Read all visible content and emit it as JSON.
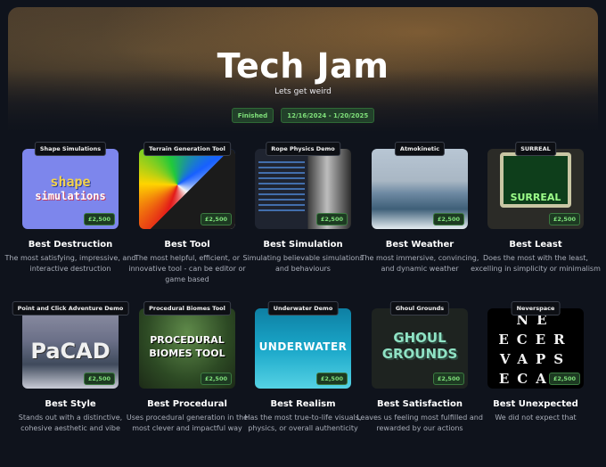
{
  "header": {
    "title": "Tech Jam",
    "subtitle": "Lets get weird",
    "status": "Finished",
    "dates": "12/16/2024 - 1/20/2025"
  },
  "categories": [
    {
      "tag": "Shape Simulations",
      "price": "£2,500",
      "title": "Best Destruction",
      "desc": "The most satisfying, impressive, and interactive destruction",
      "art": "shape simulations"
    },
    {
      "tag": "Terrain Generation Tool",
      "price": "£2,500",
      "title": "Best Tool",
      "desc": "The most helpful, efficient, or innovative tool - can be editor or game based",
      "art": ""
    },
    {
      "tag": "Rope Physics Demo",
      "price": "£2,500",
      "title": "Best Simulation",
      "desc": "Simulating believable simulations and behaviours",
      "art": ""
    },
    {
      "tag": "Atmokinetic",
      "price": "£2,500",
      "title": "Best Weather",
      "desc": "The most immersive, convincing, and dynamic weather",
      "art": ""
    },
    {
      "tag": "SURREAL",
      "price": "£2,500",
      "title": "Best Least",
      "desc": "Does the most with the least, excelling in simplicity or minimalism",
      "art": "SURREAL"
    },
    {
      "tag": "Point and Click Adventure Demo",
      "price": "£2,500",
      "title": "Best Style",
      "desc": "Stands out with a distinctive, cohesive aesthetic and vibe",
      "art": "PaCAD"
    },
    {
      "tag": "Procedural Biomes Tool",
      "price": "£2,500",
      "title": "Best Procedural",
      "desc": "Uses procedural generation in the most clever and impactful way",
      "art": "PROCEDURAL BIOMES TOOL"
    },
    {
      "tag": "Underwater Demo",
      "price": "£2,500",
      "title": "Best Realism",
      "desc": "Has the most true-to-life visuals, physics, or overall authenticity",
      "art": "UNDERWATER"
    },
    {
      "tag": "Ghoul Grounds",
      "price": "£2,500",
      "title": "Best Satisfaction",
      "desc": "Leaves us feeling most fulfilled and rewarded by our actions",
      "art": "GHOUL GROUNDS"
    },
    {
      "tag": "Neverspace",
      "price": "£2,500",
      "title": "Best Unexpected",
      "desc": "We did not expect that",
      "art": "NE ECER VAPS ECAP"
    }
  ],
  "colors": {
    "accent_green": "#7fe07a",
    "badge_bg": "#22402a",
    "bg": "#0f131c"
  }
}
